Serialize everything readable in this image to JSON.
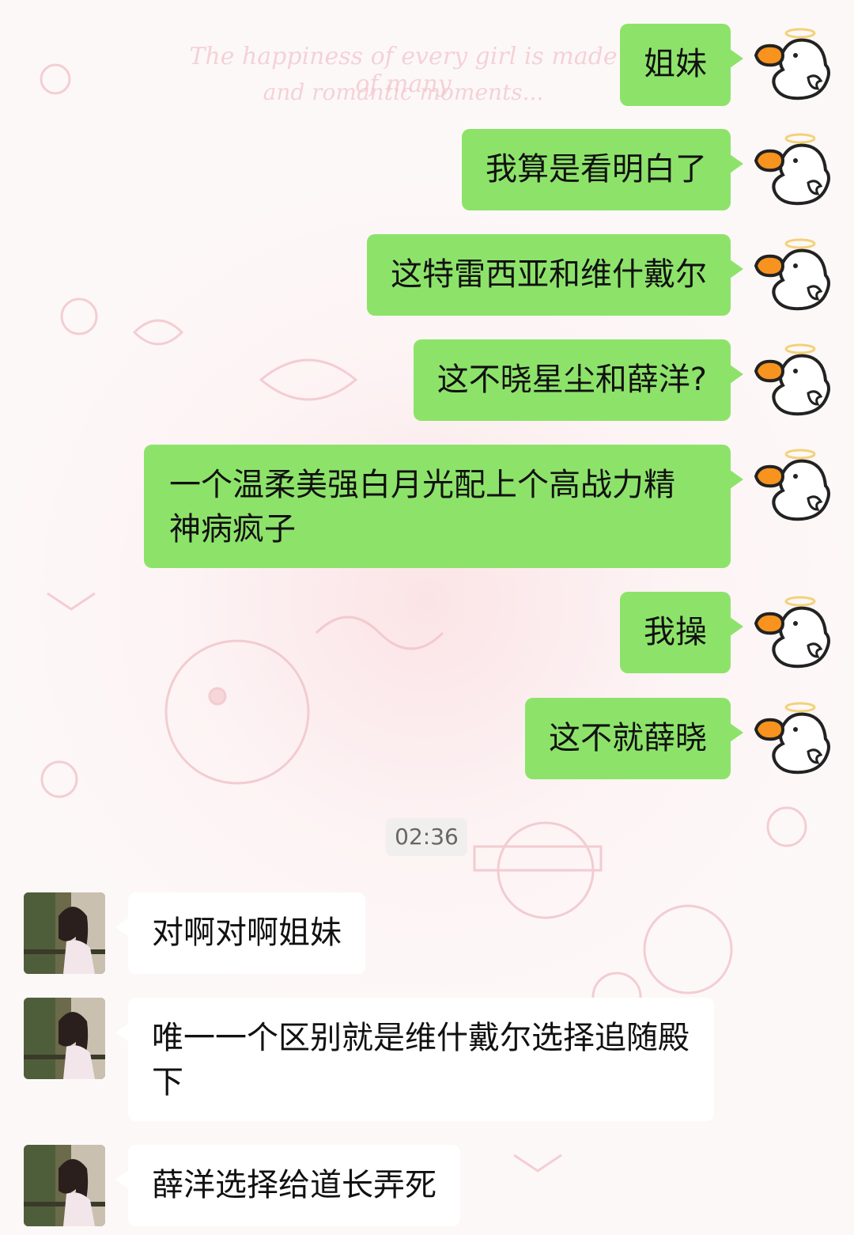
{
  "background": {
    "script_line_1": "The happiness of every girl is made of many",
    "script_line_2": "and romantic moments..."
  },
  "colors": {
    "outgoing_bubble": "#8de36a",
    "incoming_bubble": "#ffffff",
    "background": "#fdf6f7"
  },
  "outgoing": [
    {
      "text": "姐妹",
      "avatar": "angel-duck-icon"
    },
    {
      "text": "我算是看明白了",
      "avatar": "angel-duck-icon"
    },
    {
      "text": "这特雷西亚和维什戴尔",
      "avatar": "angel-duck-icon"
    },
    {
      "text": "这不晓星尘和薛洋?",
      "avatar": "angel-duck-icon"
    },
    {
      "text": "一个温柔美强白月光配上个高战力精神病疯子",
      "avatar": "angel-duck-icon"
    },
    {
      "text": "我操",
      "avatar": "angel-duck-icon"
    },
    {
      "text": "这不就薛晓",
      "avatar": "angel-duck-icon"
    }
  ],
  "timestamp": "02:36",
  "incoming": [
    {
      "text": "对啊对啊姐妹"
    },
    {
      "text": "唯一一个区别就是维什戴尔选择追随殿下"
    },
    {
      "text": "薛洋选择给道长弄死"
    }
  ]
}
